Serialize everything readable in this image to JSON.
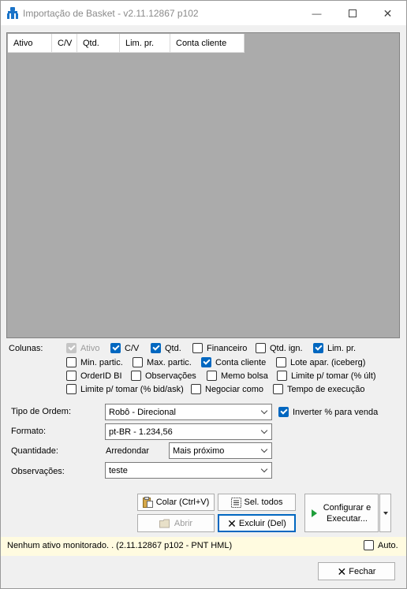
{
  "window": {
    "title": "Importação de Basket - v2.11.12867 p102",
    "minimize_glyph": "—",
    "maximize_glyph": "☐",
    "close_glyph": "✕"
  },
  "grid": {
    "columns": [
      "Ativo",
      "C/V",
      "Qtd.",
      "Lim. pr.",
      "Conta cliente"
    ]
  },
  "columns_section": {
    "label": "Colunas:",
    "options": [
      {
        "label": "Ativo",
        "checked": true,
        "disabled": true
      },
      {
        "label": "C/V",
        "checked": true
      },
      {
        "label": "Qtd.",
        "checked": true
      },
      {
        "label": "Financeiro",
        "checked": false
      },
      {
        "label": "Qtd. ign.",
        "checked": false
      },
      {
        "label": "Lim. pr.",
        "checked": true
      },
      {
        "label": "Min. partic.",
        "checked": false
      },
      {
        "label": "Max. partic.",
        "checked": false
      },
      {
        "label": "Conta cliente",
        "checked": true
      },
      {
        "label": "Lote apar. (iceberg)",
        "checked": false
      },
      {
        "label": "OrderID BI",
        "checked": false
      },
      {
        "label": "Observações",
        "checked": false
      },
      {
        "label": "Memo bolsa",
        "checked": false
      },
      {
        "label": "Limite p/ tomar (% últ)",
        "checked": false
      },
      {
        "label": "Limite p/ tomar (% bid/ask)",
        "checked": false
      },
      {
        "label": "Negociar como",
        "checked": false
      },
      {
        "label": "Tempo de execução",
        "checked": false
      }
    ]
  },
  "form": {
    "order_type_label": "Tipo de Ordem:",
    "order_type_value": "Robô - Direcional",
    "invert_label": "Inverter % para venda",
    "invert_checked": true,
    "format_label": "Formato:",
    "format_value": "pt-BR - 1.234,56",
    "quantity_label": "Quantidade:",
    "round_label": "Arredondar",
    "round_value": "Mais próximo",
    "notes_label": "Observações:",
    "notes_value": "teste"
  },
  "buttons": {
    "paste": "Colar (Ctrl+V)",
    "select_all": "Sel. todos",
    "configure": "Configurar e Executar...",
    "open": "Abrir",
    "delete": "Excluir (Del)",
    "close": "Fechar"
  },
  "status": {
    "text": "Nenhum ativo monitorado. .  (2.11.12867 p102 - PNT HML)",
    "auto_label": "Auto.",
    "auto_checked": false
  }
}
